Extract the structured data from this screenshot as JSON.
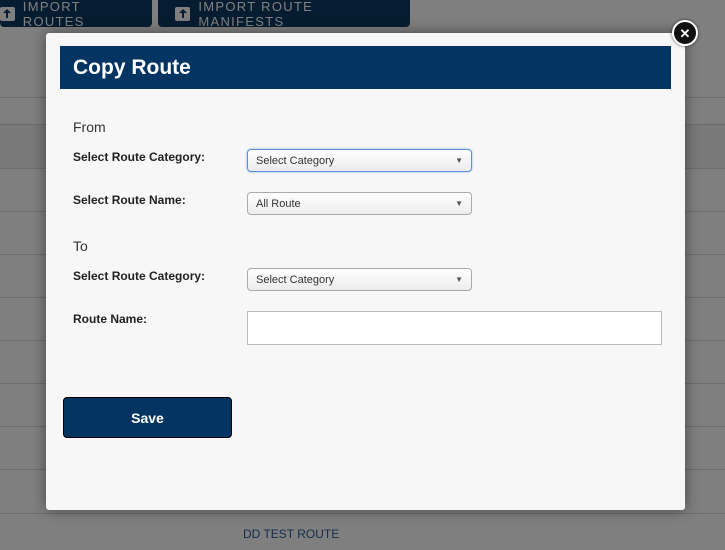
{
  "background": {
    "buttons": [
      {
        "label": "IMPORT ROUTES",
        "icon": "upload-icon"
      },
      {
        "label": "IMPORT ROUTE MANIFESTS",
        "icon": "upload-icon"
      }
    ],
    "link_text": "DD TEST ROUTE"
  },
  "modal": {
    "title": "Copy Route",
    "close_icon": "close-icon",
    "from": {
      "section_label": "From",
      "category_label": "Select Route Category:",
      "category_value": "Select Category",
      "route_label": "Select Route Name:",
      "route_value": "All Route"
    },
    "to": {
      "section_label": "To",
      "category_label": "Select Route Category:",
      "category_value": "Select Category",
      "route_name_label": "Route Name:",
      "route_name_value": ""
    },
    "save_label": "Save"
  },
  "colors": {
    "primary": "#043461",
    "overlay": "rgba(0,0,0,0.5)"
  }
}
